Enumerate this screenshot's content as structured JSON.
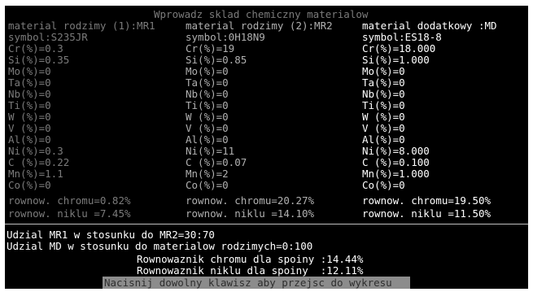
{
  "title": "Wprowadz sklad chemiczny materialow",
  "columns": [
    {
      "header": "material rodzimy (1):MR1",
      "lines": [
        "symbol:S235JR",
        "Cr(%)=0.3",
        "Si(%)=0.35",
        "Mo(%)=0",
        "Ta(%)=0",
        "Nb(%)=0",
        "Ti(%)=0",
        "W (%)=0",
        "V (%)=0",
        "Al(%)=0",
        "Ni(%)=0.3",
        "C (%)=0.22",
        "Mn(%)=1.1",
        "Co(%)=0"
      ],
      "eq_chrom": "rownow. chromu=0.82%",
      "eq_nikl": "rownow. niklu =7.45%"
    },
    {
      "header": "material rodzimy (2):MR2",
      "lines": [
        "symbol:0H18N9",
        "Cr(%)=19",
        "Si(%)=0.85",
        "Mo(%)=0",
        "Ta(%)=0",
        "Nb(%)=0",
        "Ti(%)=0",
        "W (%)=0",
        "V (%)=0",
        "Al(%)=0",
        "Ni(%)=11",
        "C (%)=0.07",
        "Mn(%)=2",
        "Co(%)=0"
      ],
      "eq_chrom": "rownow. chromu=20.27%",
      "eq_nikl": "rownow. niklu =14.10%"
    },
    {
      "header": "material dodatkowy :MD",
      "lines": [
        "symbol:ES18-8",
        "Cr(%)=18.000",
        "Si(%)=1.000",
        "Mo(%)=0",
        "Ta(%)=0",
        "Nb(%)=0",
        "Ti(%)=0",
        "W (%)=0",
        "V (%)=0",
        "Al(%)=0",
        "Ni(%)=8.000",
        "C (%)=0.100",
        "Mn(%)=1.000",
        "Co(%)=0"
      ],
      "eq_chrom": "rownow. chromu=19.50%",
      "eq_nikl": "rownow. niklu =11.50%"
    }
  ],
  "summary": {
    "mr1_ratio": "Udzial MR1 w stosunku do MR2=30:70",
    "md_ratio": "Udzial MD w stosunku do materialow rodzimych=0:100",
    "weld_chrom": "Rownowaznik chromu dla spoiny :14.44%",
    "weld_nikl": "Rownowaznik niklu dla spoiny  :12.11%"
  },
  "prompt": "Nacisnij dowolny klawisz aby przejsc do wykresu",
  "colors": {
    "background": "#000000",
    "dim_text": "#7b7b7b",
    "bright_text": "#ffffff",
    "prompt_bar": "#8c8c8c"
  }
}
